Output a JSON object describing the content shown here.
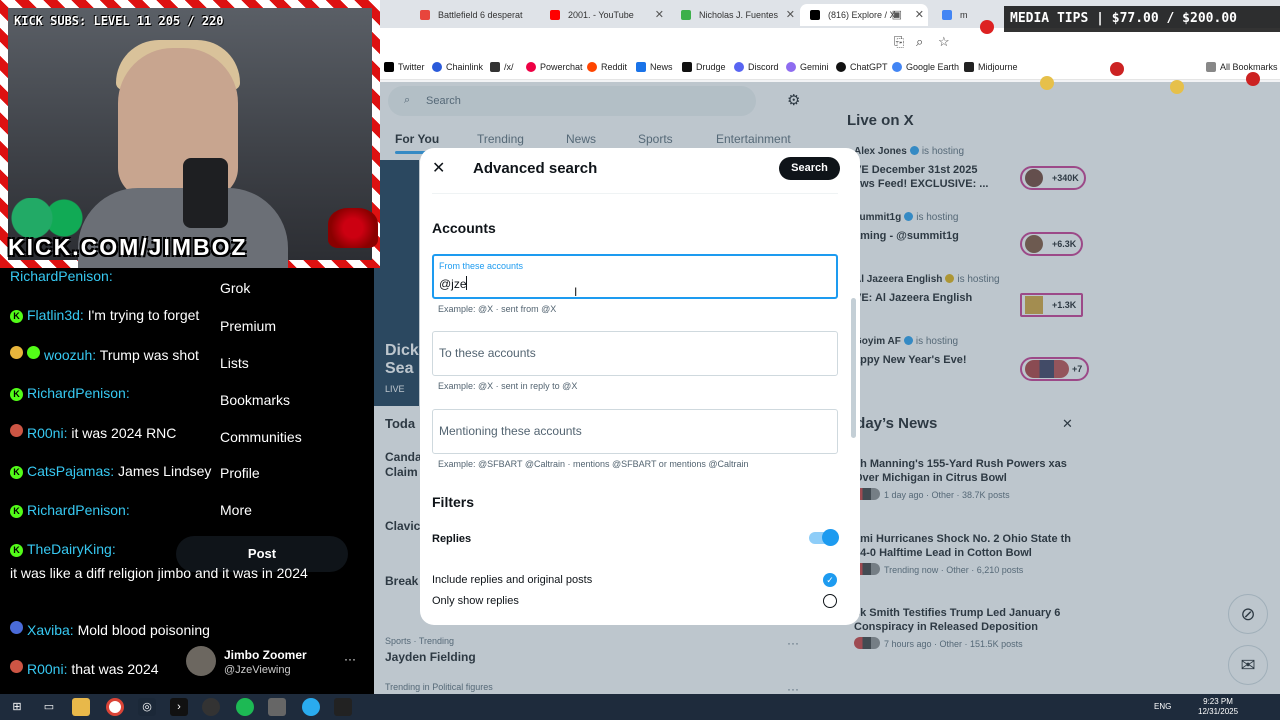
{
  "browser": {
    "tabs": [
      {
        "label": "Battlefield 6 desperat",
        "color": "#e8453c"
      },
      {
        "label": "2001. - YouTube",
        "color": "#ff0000"
      },
      {
        "label": "Nicholas J. Fuentes",
        "color": "#3db04a"
      },
      {
        "label": "(816) Explore / X",
        "color": "#000000"
      },
      {
        "label": "m",
        "color": "#4285f4"
      }
    ],
    "bookmarks": [
      "Twitter",
      "Chainlink",
      "/x/",
      "Powerchat",
      "Reddit",
      "News",
      "Drudge",
      "Discord",
      "Gemini",
      "ChatGPT",
      "Google Earth",
      "Midjourne",
      "All Bookmarks"
    ]
  },
  "x": {
    "search_placeholder": "Search",
    "tabs": [
      "For You",
      "Trending",
      "News",
      "Sports",
      "Entertainment"
    ],
    "live_card": {
      "title": "Dick Sea",
      "badge": "LIVE"
    },
    "feed": [
      "Toda",
      "Canda Claim",
      "Clavic",
      "Break"
    ],
    "trend": {
      "category": "Sports · Trending",
      "name": "Jayden Fielding",
      "next_category": "Trending in Political figures"
    },
    "live_on_x": {
      "title": "Live on X",
      "hosts": [
        {
          "name": "Alex Jones",
          "status": "is hosting",
          "title": "VE December 31st 2025 ews Feed! EXCLUSIVE: ...",
          "count": "+340K"
        },
        {
          "name": "summit1g",
          "status": "is hosting",
          "title": "aming - @summit1g",
          "count": "+6.3K"
        },
        {
          "name": "Al Jazeera English",
          "status": "is hosting",
          "title": "VE: Al Jazeera English",
          "count": "+1.3K"
        },
        {
          "name": "Goyim AF",
          "status": "is hosting",
          "title": "appy New Year's Eve!",
          "count": "+7"
        }
      ]
    },
    "todays_news": {
      "title": "oday’s News",
      "items": [
        {
          "headline": "ch Manning's 155-Yard Rush Powers xas Over Michigan in Citrus Bowl",
          "meta": "1 day ago · Other · 38.7K posts"
        },
        {
          "headline": "ami Hurricanes Shock No. 2 Ohio State th 14-0 Halftime Lead in Cotton Bowl",
          "meta": "Trending now · Other · 6,210 posts"
        },
        {
          "headline": "ck Smith Testifies Trump Led January 6 Conspiracy in Released Deposition",
          "meta": "7 hours ago · Other · 151.5K posts"
        }
      ]
    }
  },
  "modal": {
    "title": "Advanced search",
    "search_button": "Search",
    "accounts_title": "Accounts",
    "from_label": "From these accounts",
    "from_value": "@jze",
    "from_hint": "Example: @X · sent from @X",
    "to_placeholder": "To these accounts",
    "to_hint": "Example: @X · sent in reply to @X",
    "mention_placeholder": "Mentioning these accounts",
    "mention_hint": "Example: @SFBART @Caltrain · mentions @SFBART or mentions @Caltrain",
    "filters_title": "Filters",
    "replies_label": "Replies",
    "replies_on": true,
    "option_a": "Include replies and original posts",
    "option_b": "Only show replies",
    "selected_option": "Include replies and original posts"
  },
  "stream": {
    "kick_subs": "KICK SUBS: LEVEL 11 205 / 220",
    "kick_url": "KICK.COM/JIMBOZ",
    "media_tips": "MEDIA TIPS | $77.00 / $200.00",
    "chat": [
      {
        "user": "RichardPenison:",
        "text": ""
      },
      {
        "user": "Flatlin3d:",
        "text": "I'm trying to forget"
      },
      {
        "user": "woozuh:",
        "text": "Trump was shot"
      },
      {
        "user": "RichardPenison:",
        "text": ""
      },
      {
        "user": "R00ni:",
        "text": "it was 2024 RNC"
      },
      {
        "user": "CatsPajamas:",
        "text": "James Lindsey"
      },
      {
        "user": "RichardPenison:",
        "text": ""
      },
      {
        "user": "TheDairyKing:",
        "text": "it was like a diff religion jimbo and it was in 2024"
      },
      {
        "user": "Xaviba:",
        "text": "Mold blood poisoning"
      },
      {
        "user": "R00ni:",
        "text": "that was 2024"
      }
    ],
    "x_nav": [
      "Grok",
      "Premium",
      "Lists",
      "Bookmarks",
      "Communities",
      "Profile",
      "More"
    ],
    "post_button": "Post",
    "account": {
      "name": "Jimbo Zoomer",
      "handle": "@JzeViewing",
      "menu": "···"
    }
  },
  "taskbar": {
    "lang": "ENG",
    "time": "9:23 PM",
    "date": "12/31/2025"
  }
}
